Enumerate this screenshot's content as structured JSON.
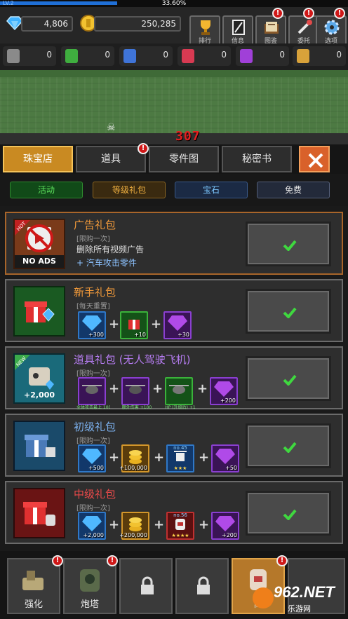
{
  "status": {
    "level": "LV.2",
    "xp_percent": "33.60%",
    "xp_fraction": 0.336
  },
  "currency": {
    "gems": "4,806",
    "coins": "250,285"
  },
  "top_buttons": [
    {
      "label": "排行",
      "icon": "trophy-icon"
    },
    {
      "label": "信息",
      "icon": "info-card-icon"
    },
    {
      "label": "图鉴",
      "icon": "book-icon"
    },
    {
      "label": "委托",
      "icon": "wrench-icon"
    },
    {
      "label": "选项",
      "icon": "gear-icon"
    }
  ],
  "resources": [
    {
      "value": "0",
      "color": "#8a8a8a"
    },
    {
      "value": "0",
      "color": "#3fae3f"
    },
    {
      "value": "0",
      "color": "#3f74d8"
    },
    {
      "value": "0",
      "color": "#d83a52"
    },
    {
      "value": "0",
      "color": "#a040d8"
    },
    {
      "value": "0",
      "color": "#d8a23a"
    }
  ],
  "scene": {
    "damage": "307"
  },
  "tabs": [
    "珠宝店",
    "道具",
    "零件图",
    "秘密书"
  ],
  "filters": [
    {
      "label": "活动",
      "bg": "#114a18",
      "color": "#5de05d"
    },
    {
      "label": "等级礼包",
      "bg": "#3a2a10",
      "color": "#f0b040"
    },
    {
      "label": "宝石",
      "bg": "#1b2a44",
      "color": "#7cc8ff"
    },
    {
      "label": "免费",
      "bg": "#232a3a",
      "color": "#e8e8e8"
    }
  ],
  "offers": {
    "ads": {
      "title": "广告礼包",
      "limit": "[限购一次]",
      "desc": "删除所有视频广告",
      "bonus": "+ 汽车攻击零件",
      "badge_hot": "HOT",
      "badge_no_ads": "NO ADS"
    },
    "newbie": {
      "title": "新手礼包",
      "limit": "[每天重置]",
      "items": [
        "+300",
        "+10",
        "+30"
      ]
    },
    "drone": {
      "title": "道具礼包 (无人驾驶飞机)",
      "limit": "[限购一次]",
      "badge_new": "NEW",
      "pic_amount": "+2,000",
      "items": [
        {
          "tiny": "全体攻击最上 100",
          "sub": "5"
        },
        {
          "tiny": "额外伤害 +100",
          "sub": ""
        },
        {
          "tiny": "HP (升级后) +1",
          "sub": "00"
        },
        {
          "amt": "+200"
        }
      ]
    },
    "basic": {
      "title": "初级礼包",
      "limit": "[限购一次]",
      "items": [
        {
          "amt": "+500"
        },
        {
          "amt": "+100,000"
        },
        {
          "no": "no.45",
          "stars": "★★★"
        },
        {
          "amt": "+50"
        }
      ]
    },
    "mid": {
      "title": "中级礼包",
      "limit": "[限购一次]",
      "items": [
        {
          "amt": "+2,000"
        },
        {
          "amt": "+200,000"
        },
        {
          "no": "no.56",
          "stars": "★★★★"
        },
        {
          "amt": "+200"
        }
      ]
    }
  },
  "bottom_nav": [
    {
      "label": "强化",
      "icon": "wrench-gear-icon"
    },
    {
      "label": "炮塔",
      "icon": "turret-icon"
    },
    {
      "label": "",
      "icon": "lock-icon"
    },
    {
      "label": "",
      "icon": "lock-icon"
    },
    {
      "label": "商",
      "icon": "jar-icon"
    }
  ],
  "watermark": {
    "brand": "962.NET",
    "sub": "乐游网"
  }
}
